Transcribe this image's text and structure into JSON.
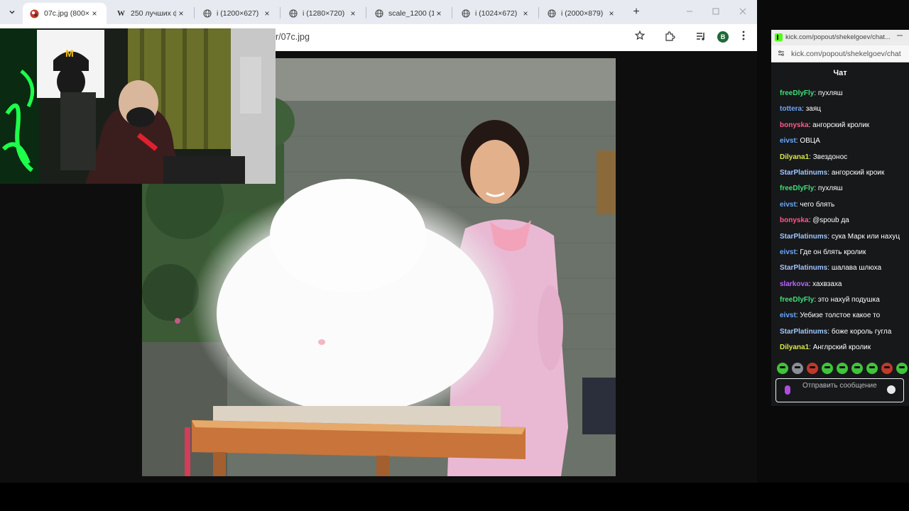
{
  "browser": {
    "tabs": [
      {
        "title": "07c.jpg (800×",
        "favicon": "image-icon",
        "active": true
      },
      {
        "title": "250 лучших ф",
        "favicon": "wikipedia-icon",
        "active": false
      },
      {
        "title": "i (1200×627)",
        "favicon": "globe-icon",
        "active": false
      },
      {
        "title": "i (1280×720)",
        "favicon": "globe-icon",
        "active": false
      },
      {
        "title": "scale_1200 (1",
        "favicon": "globe-icon",
        "active": false
      },
      {
        "title": "i (1024×672)",
        "favicon": "globe-icon",
        "active": false
      },
      {
        "title": "i (2000×879)",
        "favicon": "globe-icon",
        "active": false
      }
    ],
    "tab_close_glyph": "×",
    "new_tab_glyph": "+",
    "url": "r/07c.jpg",
    "profile_initial": "B",
    "icons": {
      "menu": "chevron-down-icon",
      "bookmark": "star-icon",
      "extensions": "puzzle-icon",
      "media": "media-control-icon",
      "more": "kebab-menu-icon"
    }
  },
  "chat": {
    "window_title": "kick.com/popout/shekelgoev/chat...",
    "url": "kick.com/popout/shekelgoev/chat",
    "header": "Чат",
    "messages": [
      {
        "user": "freeDlyFly",
        "color": "#3ee07a",
        "text": "пухляш"
      },
      {
        "user": "tottera",
        "color": "#6ba7ff",
        "text": "заяц"
      },
      {
        "user": "bonyska",
        "color": "#ff5a8a",
        "text": "ангорский кролик"
      },
      {
        "user": "eivst",
        "color": "#6ba7ff",
        "text": "ОВЦА"
      },
      {
        "user": "Dilyana1",
        "color": "#d8e84a",
        "text": "Звездонос"
      },
      {
        "user": "StarPlatinums",
        "color": "#9fc6ff",
        "text": "ангорский кроик"
      },
      {
        "user": "freeDlyFly",
        "color": "#3ee07a",
        "text": "пухляш"
      },
      {
        "user": "eivst",
        "color": "#6ba7ff",
        "text": "чего блять"
      },
      {
        "user": "bonyska",
        "color": "#ff5a8a",
        "text": "@spoub да"
      },
      {
        "user": "StarPlatinums",
        "color": "#9fc6ff",
        "text": "сука Марк или нахуц"
      },
      {
        "user": "eivst",
        "color": "#6ba7ff",
        "text": "Где он блять кролик"
      },
      {
        "user": "StarPlatinums",
        "color": "#9fc6ff",
        "text": "шалава шлюха"
      },
      {
        "user": "slarkova",
        "color": "#b766ff",
        "text": "хахвзаха"
      },
      {
        "user": "freeDlyFly",
        "color": "#3ee07a",
        "text": "это нахуй подушка"
      },
      {
        "user": "eivst",
        "color": "#6ba7ff",
        "text": "Уебизе толстое какое то"
      },
      {
        "user": "StarPlatinums",
        "color": "#9fc6ff",
        "text": "боже король гугла"
      },
      {
        "user": "Dilyana1",
        "color": "#d8e84a",
        "text": "Англрский кролик"
      }
    ],
    "input_placeholder": "Отправить сообщение",
    "icons": {
      "mic": "microphone-icon",
      "emoji": "emoji-icon",
      "site": "kick-logo-icon"
    }
  }
}
